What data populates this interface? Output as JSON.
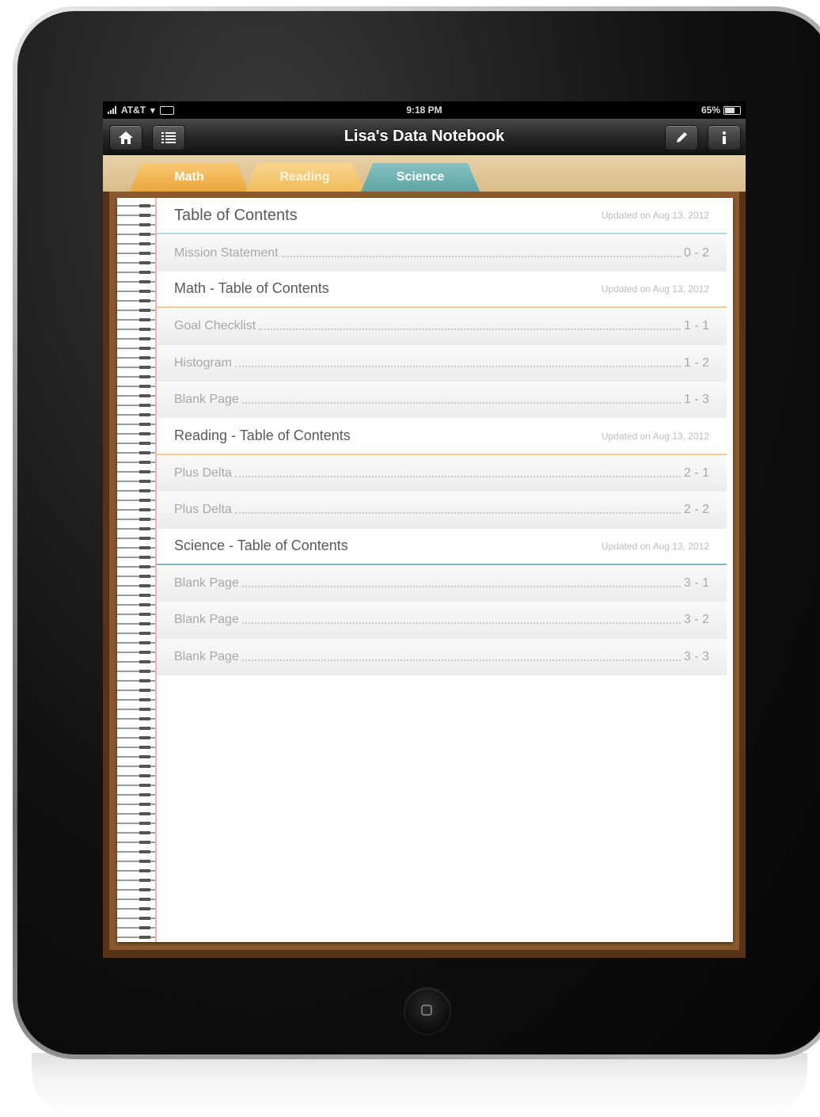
{
  "status_bar": {
    "carrier": "AT&T",
    "time": "9:18 PM",
    "battery": "65%"
  },
  "nav_bar": {
    "title": "Lisa's Data Notebook",
    "left_icons": [
      "home-icon",
      "list-icon"
    ],
    "right_icons": [
      "pencil-icon",
      "info-icon"
    ]
  },
  "tabs": [
    {
      "label": "Math",
      "color": "#eba73e"
    },
    {
      "label": "Reading",
      "color": "#f0bc5c"
    },
    {
      "label": "Science",
      "color": "#5ea5a4",
      "selected": true
    }
  ],
  "toc": {
    "main": {
      "title": "Table of Contents",
      "updated": "Updated on Aug 13, 2012"
    },
    "mission": {
      "title": "Mission Statement",
      "page": "0 - 2"
    },
    "math": {
      "title": "Math - Table of Contents",
      "updated": "Updated on Aug 13, 2012"
    },
    "math_items": [
      {
        "title": "Goal Checklist",
        "page": "1 - 1"
      },
      {
        "title": "Histogram",
        "page": "1 - 2"
      },
      {
        "title": "Blank Page",
        "page": "1 - 3"
      }
    ],
    "reading": {
      "title": "Reading - Table of Contents",
      "updated": "Updated on Aug 13, 2012"
    },
    "reading_items": [
      {
        "title": "Plus Delta",
        "page": "2 - 1"
      },
      {
        "title": "Plus Delta",
        "page": "2 - 2"
      }
    ],
    "science": {
      "title": "Science - Table of Contents",
      "updated": "Updated on Aug 13, 2012"
    },
    "science_items": [
      {
        "title": "Blank Page",
        "page": "3 - 1"
      },
      {
        "title": "Blank Page",
        "page": "3 - 2"
      },
      {
        "title": "Blank Page",
        "page": "3 - 3"
      }
    ]
  }
}
